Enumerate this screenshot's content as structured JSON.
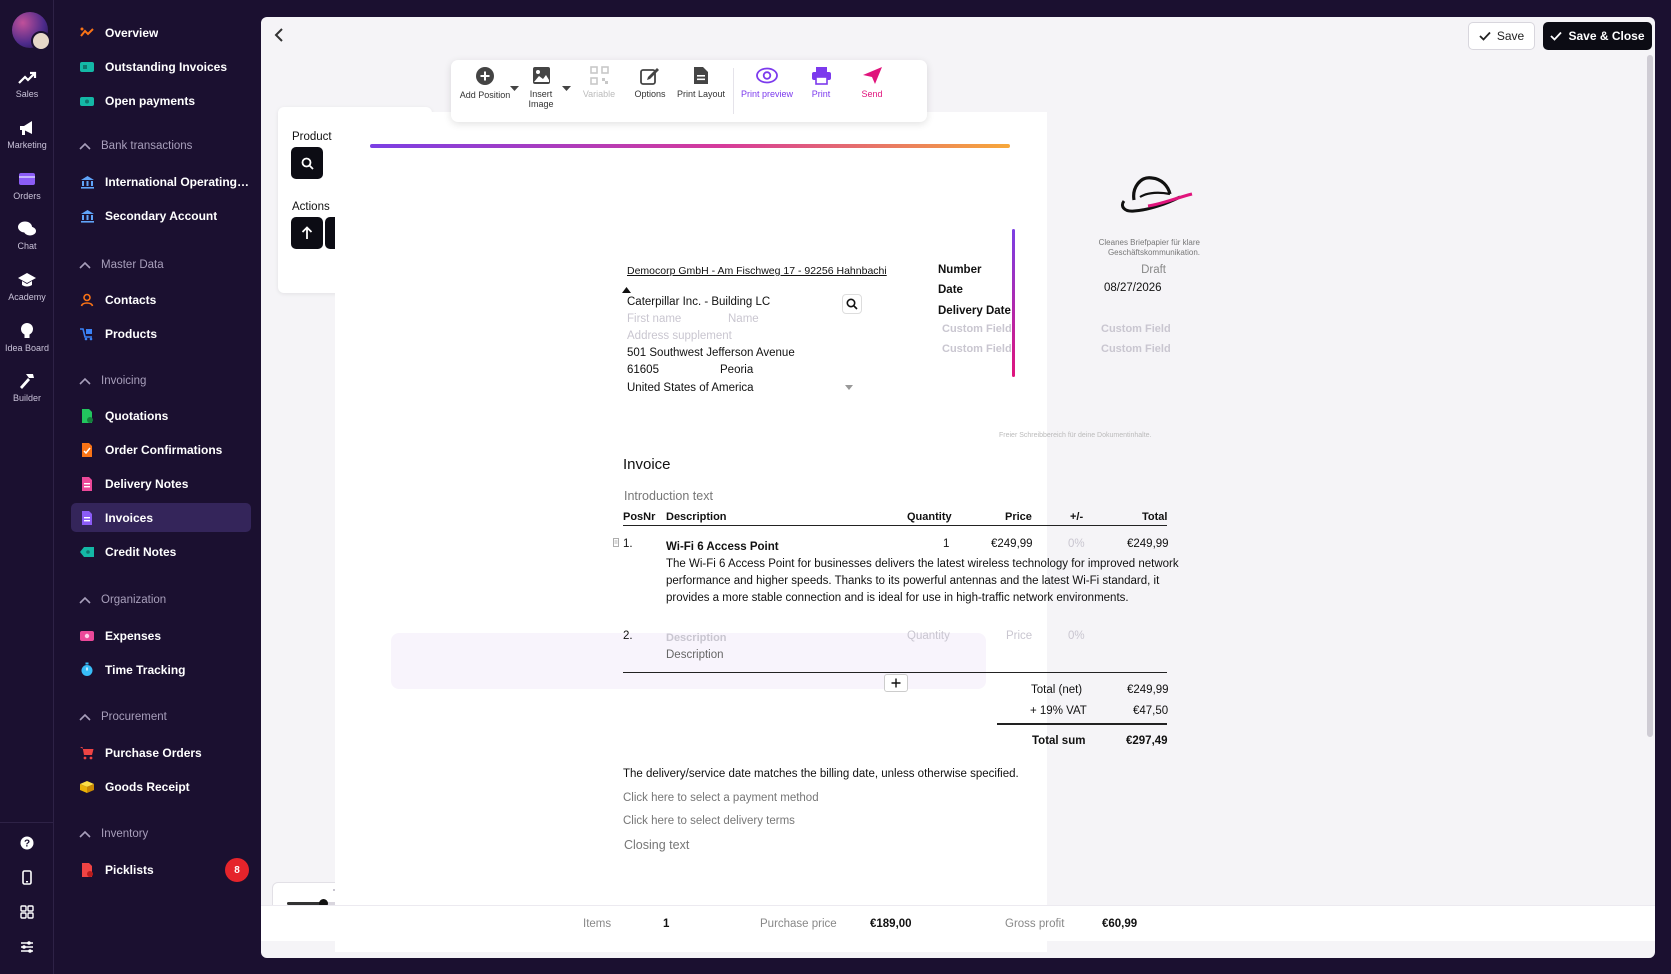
{
  "rail": {
    "items": [
      {
        "label": "Sales",
        "icon": "trending-up-icon"
      },
      {
        "label": "Marketing",
        "icon": "megaphone-icon"
      },
      {
        "label": "Orders",
        "icon": "orders-icon"
      },
      {
        "label": "Chat",
        "icon": "chat-icon"
      },
      {
        "label": "Academy",
        "icon": "graduation-cap-icon"
      },
      {
        "label": "Idea Board",
        "icon": "lightbulb-icon"
      },
      {
        "label": "Builder",
        "icon": "hammer-icon"
      }
    ]
  },
  "nav": {
    "overview": "Overview",
    "outstanding_invoices": "Outstanding Invoices",
    "open_payments": "Open payments",
    "group_bank": "Bank transactions",
    "international_account": "International Operating Ac...",
    "secondary_account": "Secondary Account",
    "group_master": "Master Data",
    "contacts": "Contacts",
    "products": "Products",
    "group_invoicing": "Invoicing",
    "quotations": "Quotations",
    "order_confirmations": "Order Confirmations",
    "delivery_notes": "Delivery Notes",
    "invoices": "Invoices",
    "credit_notes": "Credit Notes",
    "group_organization": "Organization",
    "expenses": "Expenses",
    "time_tracking": "Time Tracking",
    "group_procurement": "Procurement",
    "purchase_orders": "Purchase Orders",
    "goods_receipt": "Goods Receipt",
    "group_inventory": "Inventory",
    "picklists": "Picklists",
    "picklists_badge": "8"
  },
  "header": {
    "save_label": "Save",
    "save_close_label": "Save & Close"
  },
  "side_panel": {
    "product_label": "Product",
    "actions_label": "Actions"
  },
  "toolbar": {
    "add_position": "Add Position",
    "insert_image_1": "Insert",
    "insert_image_2": "Image",
    "variable": "Variable",
    "options": "Options",
    "print_layout": "Print Layout",
    "print_preview": "Print preview",
    "print": "Print",
    "send": "Send"
  },
  "document": {
    "letterhead_line1": "Cleanes Briefpapier für klare",
    "letterhead_line2": "Geschäftskommunikation.",
    "sender_line": "Democorp GmbH - Am Fischweg 17 - 92256 Hahnbachi",
    "recipient": {
      "company": "Caterpillar Inc. - Building LC",
      "first_name_placeholder": "First name",
      "name_placeholder": "Name",
      "address_supplement_placeholder": "Address supplement",
      "street": "501 Southwest Jefferson Avenue",
      "zip": "61605",
      "city": "Peoria",
      "country": "United States of America"
    },
    "meta": {
      "number_label": "Number",
      "number_value": "Draft",
      "date_label": "Date",
      "date_value": "08/27/2026",
      "delivery_date_label": "Delivery Date",
      "custom_field": "Custom Field"
    },
    "free_text_hint": "Freier Schreibbereich für deine Dokumentinhalte.",
    "title": "Invoice",
    "intro_placeholder": "Introduction text",
    "table": {
      "headers": {
        "posnr": "PosNr",
        "description": "Description",
        "quantity": "Quantity",
        "price": "Price",
        "discount": "+/-",
        "total": "Total"
      },
      "rows": [
        {
          "pos": "1.",
          "name": "Wi-Fi 6 Access Point",
          "quantity": "1",
          "price": "€249,99",
          "discount": "0%",
          "total": "€249,99",
          "desc_line1": "The Wi-Fi 6 Access Point for businesses delivers the latest wireless technology for improved network",
          "desc_line2": "performance and higher speeds. Thanks to its powerful antennas and the latest Wi-Fi standard, it",
          "desc_line3": "provides a more stable connection and is ideal for use in high-traffic network environments."
        },
        {
          "pos": "2.",
          "name_placeholder": "Description",
          "quantity_placeholder": "Quantity",
          "price_placeholder": "Price",
          "discount": "0%",
          "desc_placeholder": "Description"
        }
      ]
    },
    "totals": {
      "net_label": "Total (net)",
      "net_value": "€249,99",
      "vat_label": "+ 19% VAT",
      "vat_value": "€47,50",
      "sum_label": "Total sum",
      "sum_value": "€297,49"
    },
    "delivery_note": "The delivery/service date matches the billing date, unless otherwise specified.",
    "payment_method": "Click here to select a payment method",
    "delivery_terms": "Click here to select delivery terms",
    "closing_placeholder": "Closing text"
  },
  "footer": {
    "items_label": "Items",
    "items_value": "1",
    "purchase_label": "Purchase price",
    "purchase_value": "€189,00",
    "profit_label": "Gross profit",
    "profit_value": "€60,99"
  },
  "zoom": {
    "level": 0.3
  },
  "colors": {
    "accent_purple": "#7c3aed",
    "accent_pink": "#e0147c",
    "nav_bg": "#1b1030",
    "active_bg": "#34255a"
  }
}
